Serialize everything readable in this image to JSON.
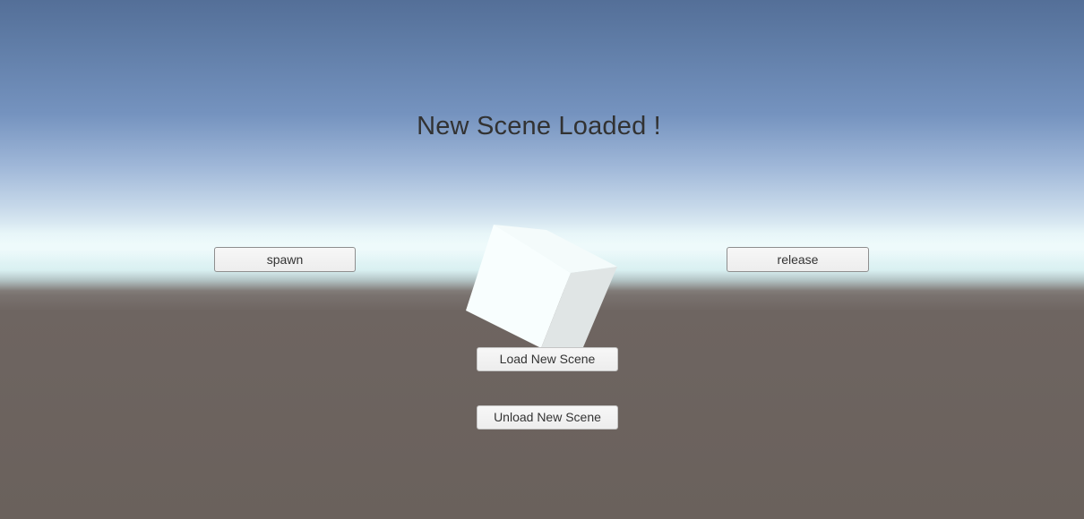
{
  "scene": {
    "title": "New Scene Loaded !",
    "object": "cube",
    "colors": {
      "sky_top": "#546f98",
      "horizon": "#eef9fb",
      "ground": "#6a615c",
      "text": "#323232",
      "cube_light": "#f8fefe",
      "cube_side": "#e0e5e5"
    }
  },
  "buttons": {
    "spawn": "spawn",
    "release": "release",
    "load": "Load New Scene",
    "unload": "Unload New Scene"
  }
}
